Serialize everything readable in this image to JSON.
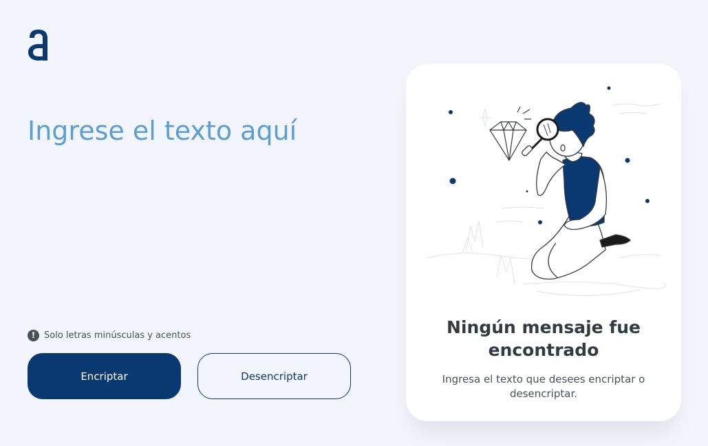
{
  "logo": {
    "icon": "alura-a-logo",
    "color": "#0a3871"
  },
  "input": {
    "placeholder": "Ingrese el texto aquí",
    "value": ""
  },
  "hint": {
    "icon": "exclamation-circle-icon",
    "text": "Solo letras minúsculas y acentos"
  },
  "buttons": {
    "encrypt_label": "Encriptar",
    "decrypt_label": "Desencriptar"
  },
  "output_panel": {
    "illustration": "person-with-magnifying-glass-looking-at-diamond",
    "title": "Ningún mensaje fue encontrado",
    "message": "Ingresa el texto que desees encriptar o desencriptar."
  },
  "colors": {
    "background": "#f3f5fc",
    "primary": "#0a3871",
    "placeholder": "#5b9ed1",
    "text": "#343a40",
    "muted": "#495057",
    "card": "#ffffff"
  }
}
